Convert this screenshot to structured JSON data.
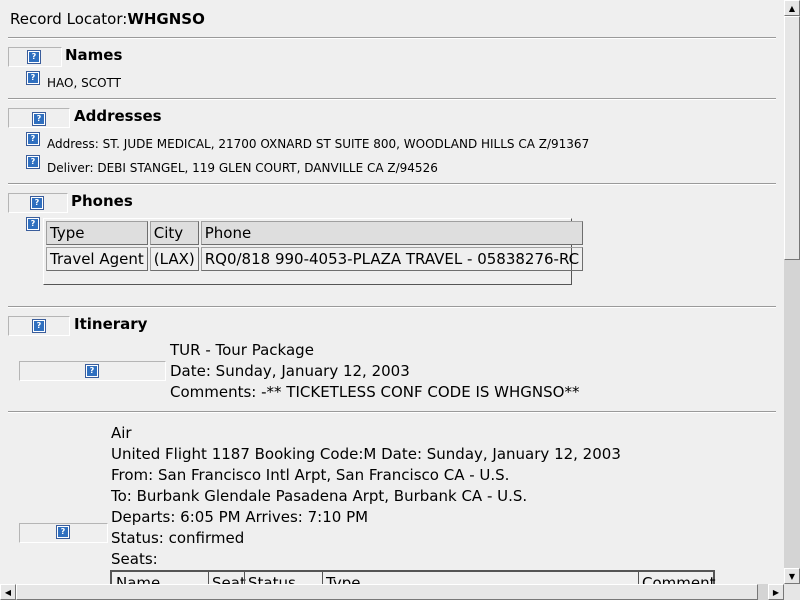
{
  "record": {
    "label": "Record Locator:",
    "value": "WHGNSO"
  },
  "icons": {
    "help": "?"
  },
  "names": {
    "title": "Names",
    "items": [
      "HAO, SCOTT"
    ]
  },
  "addresses": {
    "title": "Addresses",
    "items": [
      "Address: ST. JUDE MEDICAL, 21700 OXNARD ST SUITE 800, WOODLAND HILLS CA Z/91367",
      "Deliver: DEBI STANGEL, 119 GLEN COURT, DANVILLE CA Z/94526"
    ]
  },
  "phones": {
    "title": "Phones",
    "headers": [
      "Type",
      "City",
      "Phone"
    ],
    "rows": [
      [
        "Travel Agent",
        "(LAX)",
        "RQ0/818 990-4053-PLAZA TRAVEL - 05838276-RC"
      ]
    ]
  },
  "itinerary": {
    "title": "Itinerary",
    "tour": {
      "line1": "TUR - Tour Package",
      "line2": "Date: Sunday, January 12, 2003",
      "line3": "Comments: -** TICKETLESS CONF CODE IS WHGNSO**"
    },
    "air": {
      "line1": "Air",
      "line2": "United Flight 1187 Booking Code:M Date: Sunday, January 12, 2003",
      "line3": "From: San Francisco Intl Arpt, San Francisco CA - U.S.",
      "line4": "To: Burbank Glendale Pasadena Arpt, Burbank CA - U.S.",
      "line5": "Departs: 6:05 PM Arrives: 7:10 PM",
      "line6": "Status: confirmed",
      "line7": "Seats:",
      "seat_headers": [
        "Name",
        "Seat",
        "Status",
        "Type",
        "Comment"
      ]
    }
  },
  "scrollbar": {
    "up": "▲",
    "down": "▼",
    "left": "◀",
    "right": "▶"
  }
}
